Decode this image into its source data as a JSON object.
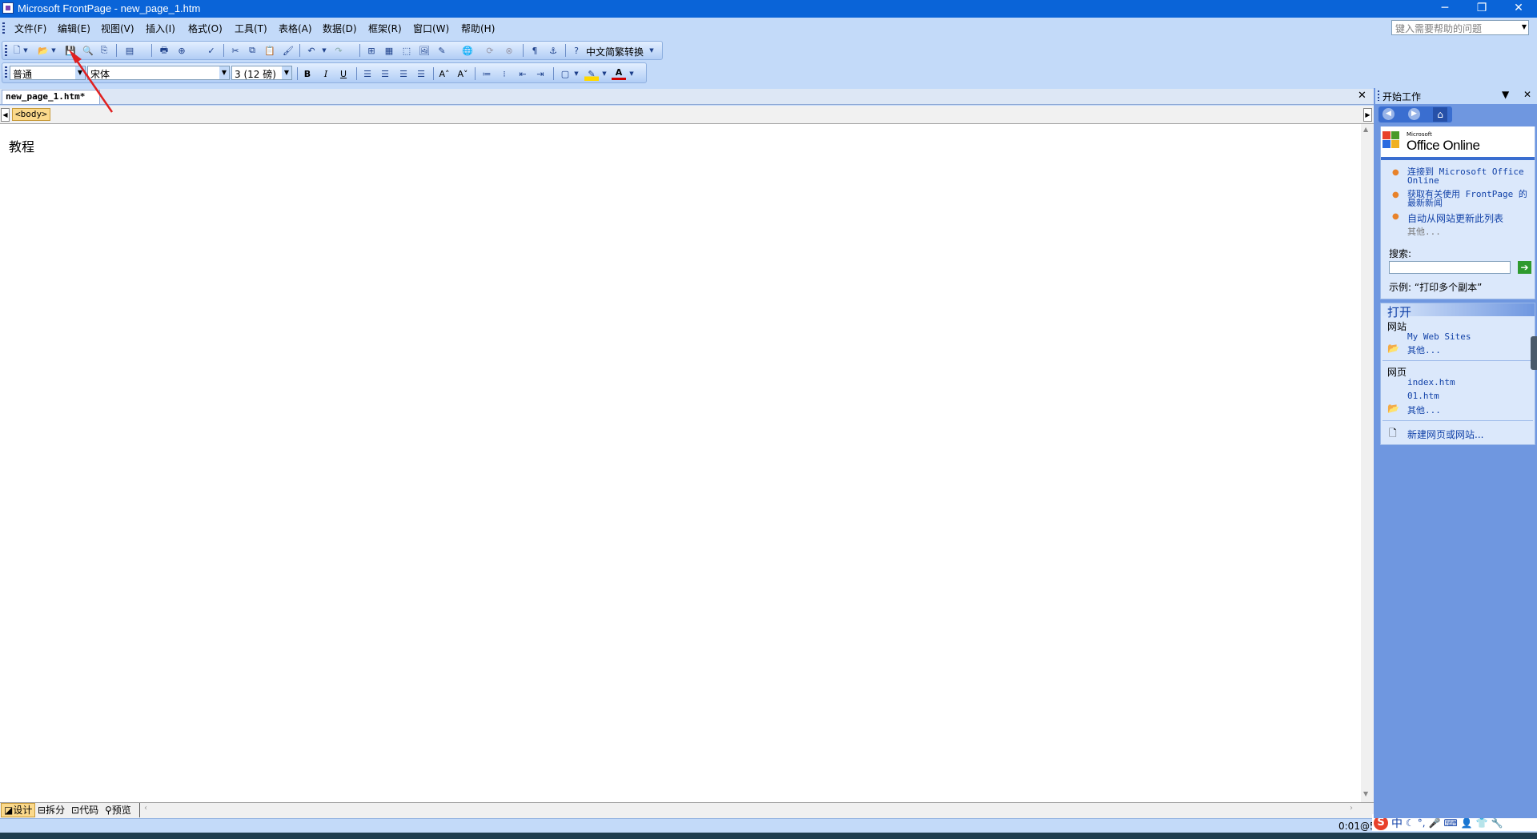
{
  "window": {
    "title": "Microsoft FrontPage - new_page_1.htm",
    "minimize": "─",
    "restore": "❐",
    "close": "✕"
  },
  "menu": {
    "items": [
      "文件(F)",
      "编辑(E)",
      "视图(V)",
      "插入(I)",
      "格式(O)",
      "工具(T)",
      "表格(A)",
      "数据(D)",
      "框架(R)",
      "窗口(W)",
      "帮助(H)"
    ],
    "help_placeholder": "键入需要帮助的问题"
  },
  "toolbar": {
    "conversion_label": "中文简繁转换"
  },
  "format_toolbar": {
    "style": "普通",
    "font": "宋体",
    "size": "3 (12 磅)",
    "bold": "B",
    "italic": "I",
    "underline": "U"
  },
  "document": {
    "tab_label": "new_page_1.htm*",
    "close": "✕",
    "tag": "<body>",
    "content": "教程"
  },
  "view_tabs": [
    "设计",
    "拆分",
    "代码",
    "预览"
  ],
  "status": {
    "timer": "0:01@5"
  },
  "task_pane": {
    "title": "开始工作",
    "office_online_small": "Microsoft",
    "office_online": "Office Online",
    "links": [
      "连接到 Microsoft Office Online",
      "获取有关使用 FrontPage 的最新新闻",
      "自动从网站更新此列表"
    ],
    "more": "其他...",
    "search_label": "搜索:",
    "example": "示例: “打印多个副本”",
    "open_header": "打开",
    "sites_label": "网站",
    "site_items": [
      "My Web Sites"
    ],
    "site_more": "其他...",
    "pages_label": "网页",
    "page_items": [
      "index.htm",
      "01.htm"
    ],
    "page_more": "其他...",
    "new_link": "新建网页或网站..."
  },
  "tray": {
    "ime": "中"
  },
  "colors": {
    "titlebar": "#0a64d8",
    "menubar": "#c3daf9",
    "taskpane": "#6f97e0",
    "annotation_arrow": "#e02020"
  }
}
